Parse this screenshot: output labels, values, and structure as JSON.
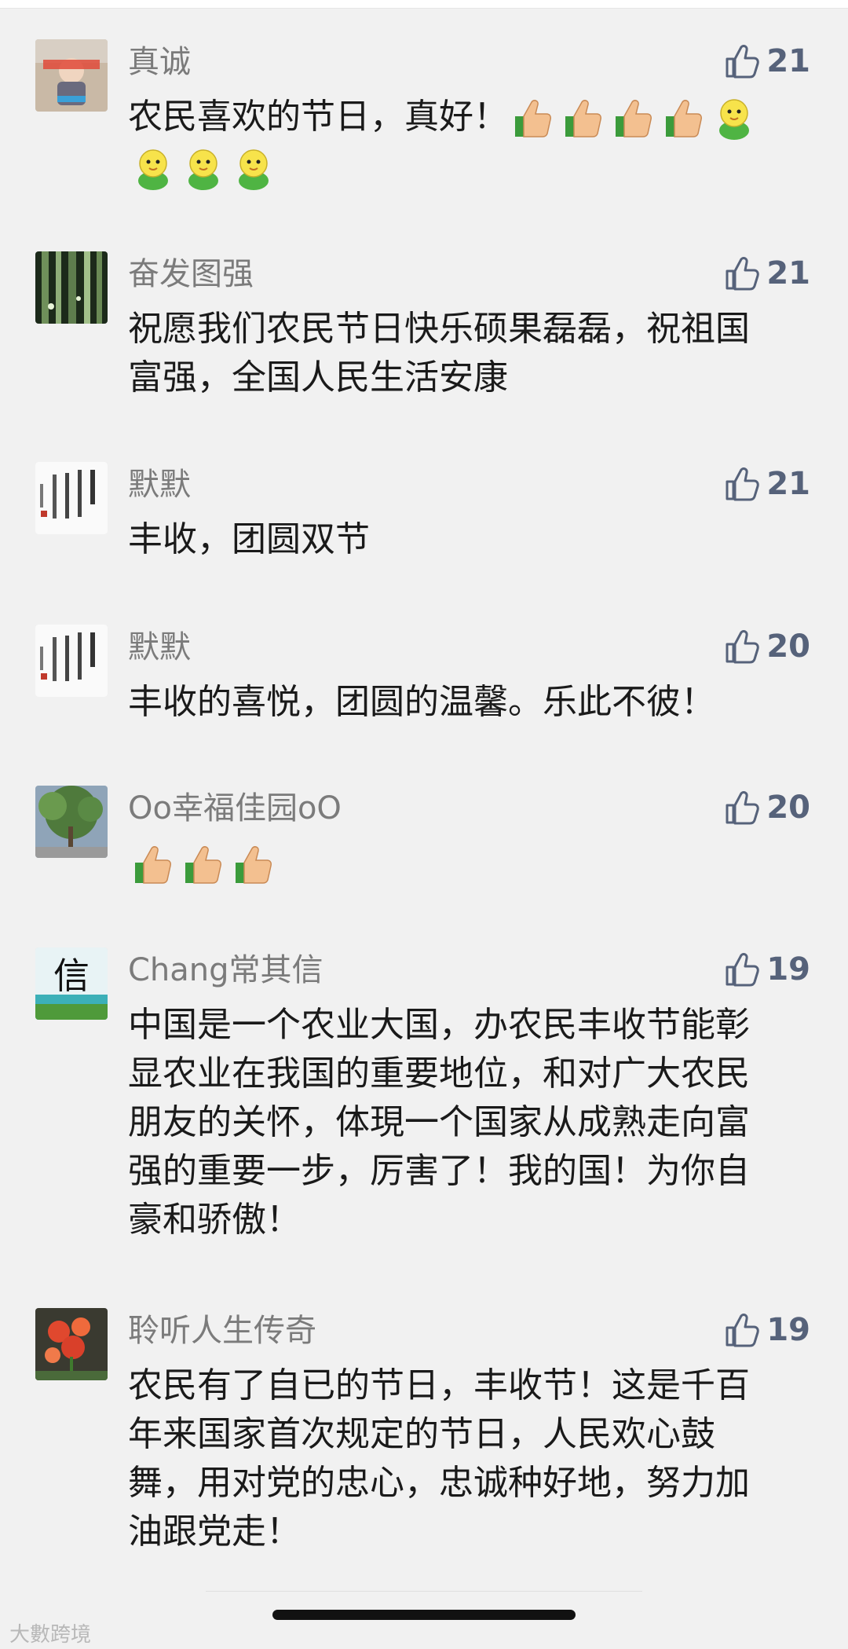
{
  "colors": {
    "background": "#f1f1f1",
    "name": "#7b7b7b",
    "text": "#1a1a1a",
    "like": "#56627a"
  },
  "comments": [
    {
      "name": "真诚",
      "likes": "21",
      "text": "农民喜欢的节日，真好！",
      "emojis": [
        "thumbs-up",
        "thumbs-up",
        "thumbs-up",
        "thumbs-up",
        "chick",
        "chick",
        "chick",
        "chick"
      ]
    },
    {
      "name": "奋发图强",
      "likes": "21",
      "text": "祝愿我们农民节日快乐硕果磊磊，祝祖国富强，全国人民生活安康"
    },
    {
      "name": "默默",
      "likes": "21",
      "text": "丰收，团圆双节"
    },
    {
      "name": "默默",
      "likes": "20",
      "text": "丰收的喜悦，团圆的温馨。乐此不彼！"
    },
    {
      "name": "Oo幸福佳园oO",
      "likes": "20",
      "text": "",
      "emojis": [
        "thumbs-up",
        "thumbs-up",
        "thumbs-up"
      ]
    },
    {
      "name": "Chang常其信",
      "likes": "19",
      "text": "中国是一个农业大国，办农民丰收节能彰显农业在我国的重要地位，和对广大农民朋友的关怀，体現一个国家从成熟走向富强的重要一步，厉害了！我的国！为你自豪和骄傲！"
    },
    {
      "name": "聆听人生传奇",
      "likes": "19",
      "text": "农民有了自已的节日，丰收节！这是千百年来国家首次规定的节日，人民欢心鼓舞，用对党的忠心，忠诚种好地，努力加油跟党走！"
    }
  ],
  "avatars": {
    "zhencheng": "child-photo",
    "fenfa": "bamboo-photo",
    "momo": "calligraphy",
    "oo": "tree-photo",
    "chang": "xin-character",
    "lingting": "red-flower-photo"
  },
  "avatar_text": {
    "chang": "信"
  },
  "watermark": "大數跨境"
}
